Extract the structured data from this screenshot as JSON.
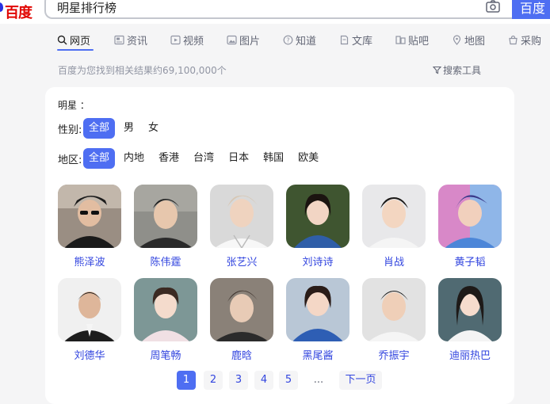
{
  "header": {
    "logo_text": "百度",
    "search_value": "明星排行榜",
    "search_button": "百度"
  },
  "tabs": [
    {
      "label": "网页",
      "icon": "search-icon"
    },
    {
      "label": "资讯",
      "icon": "news-icon"
    },
    {
      "label": "视频",
      "icon": "video-icon"
    },
    {
      "label": "图片",
      "icon": "image-icon"
    },
    {
      "label": "知道",
      "icon": "question-icon"
    },
    {
      "label": "文库",
      "icon": "document-icon"
    },
    {
      "label": "贴吧",
      "icon": "tieba-icon"
    },
    {
      "label": "地图",
      "icon": "map-icon"
    },
    {
      "label": "采购",
      "icon": "shopping-icon"
    }
  ],
  "result_count": "百度为您找到相关结果约69,100,000个",
  "tools_label": "搜索工具",
  "card": {
    "title": "明星 ：",
    "gender": {
      "label": "性别:",
      "options": [
        "全部",
        "男",
        "女"
      ]
    },
    "region": {
      "label": "地区:",
      "options": [
        "全部",
        "内地",
        "香港",
        "台湾",
        "日本",
        "韩国",
        "欧美"
      ]
    },
    "people": [
      {
        "name": "熊泽波"
      },
      {
        "name": "陈伟霆"
      },
      {
        "name": "张艺兴"
      },
      {
        "name": "刘诗诗"
      },
      {
        "name": "肖战"
      },
      {
        "name": "黄子韬"
      },
      {
        "name": "刘德华"
      },
      {
        "name": "周笔畅"
      },
      {
        "name": "鹿晗"
      },
      {
        "name": "黑尾酱"
      },
      {
        "name": "乔振宇"
      },
      {
        "name": "迪丽热巴"
      }
    ]
  },
  "pagination": {
    "pages": [
      "1",
      "2",
      "3",
      "4",
      "5"
    ],
    "ellipsis": "...",
    "next": "下一页"
  },
  "colors": {
    "accent": "#4e6ef2",
    "link": "#3245df",
    "logo_red": "#e10602"
  }
}
